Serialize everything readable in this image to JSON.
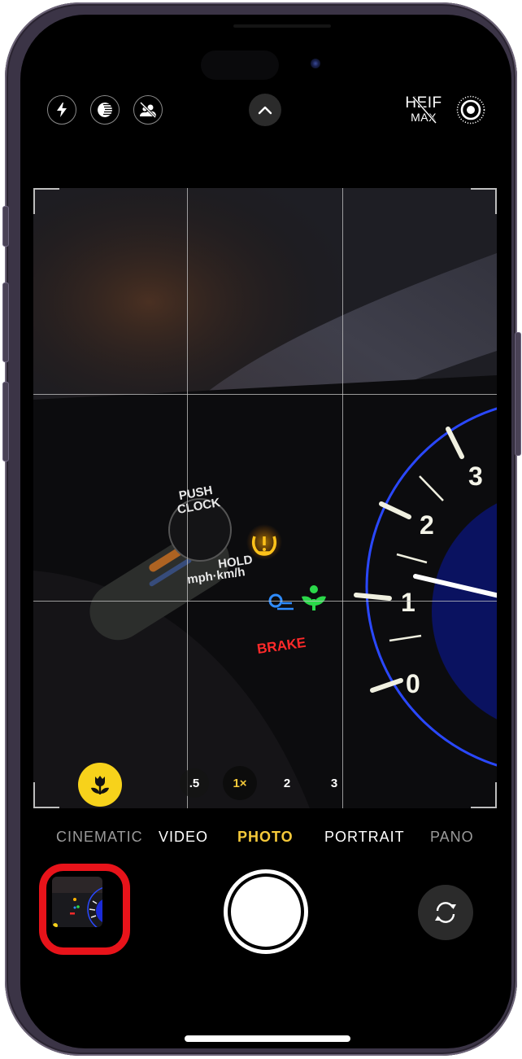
{
  "device": {
    "frame_color": "#3b3446"
  },
  "top_controls": {
    "flash": {
      "icon": "flash-icon",
      "state": "auto"
    },
    "night_mode": {
      "icon": "night-mode-icon",
      "state": "available"
    },
    "live_portrait": {
      "icon": "person-slash-icon",
      "state": "off"
    },
    "expand": {
      "icon": "chevron-up-icon"
    },
    "format": {
      "line1": "HEIF",
      "line2": "MAX",
      "state": "off"
    },
    "live_photo": {
      "icon": "live-photo-icon",
      "state": "on"
    }
  },
  "viewfinder": {
    "grid": "3x3",
    "scene_labels": {
      "push": "PUSH",
      "clock": "CLOCK",
      "hold": "HOLD",
      "units": "mph·km/h",
      "brake": "BRAKE",
      "gauge_ticks": [
        "0",
        "1",
        "2",
        "3"
      ]
    },
    "macro_button": {
      "icon": "macro-flower-icon",
      "color": "#f7d21b",
      "active": true
    },
    "zoom_levels": [
      {
        "label": ".5",
        "active": false
      },
      {
        "label": "1×",
        "active": true
      },
      {
        "label": "2",
        "active": false
      },
      {
        "label": "3",
        "active": false
      }
    ]
  },
  "modes": {
    "items": [
      "CINEMATIC",
      "VIDEO",
      "PHOTO",
      "PORTRAIT",
      "PANO"
    ],
    "selected": "PHOTO",
    "accent": "#f5c93a"
  },
  "bottom_controls": {
    "thumbnail": {
      "highlight_color": "#e8131a",
      "label": "last-photo-thumbnail"
    },
    "shutter": {
      "label": "shutter"
    },
    "flip_camera": {
      "icon": "camera-flip-icon"
    }
  }
}
